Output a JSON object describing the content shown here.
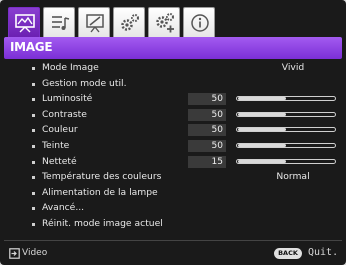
{
  "tabs": [
    {
      "icon": "display-picture-icon",
      "active": true
    },
    {
      "icon": "audio-settings-icon",
      "active": false
    },
    {
      "icon": "install-icon",
      "active": false
    },
    {
      "icon": "system-setup-icon",
      "active": false
    },
    {
      "icon": "advanced-setup-icon",
      "active": false
    },
    {
      "icon": "information-icon",
      "active": false
    }
  ],
  "section_title": "IMAGE",
  "menu": [
    {
      "label": "Mode Image",
      "value": "Vivid"
    },
    {
      "label": "Gestion mode util."
    },
    {
      "label": "Luminosité",
      "number": "50",
      "level": 0.5
    },
    {
      "label": "Contraste",
      "number": "50",
      "level": 0.5
    },
    {
      "label": "Couleur",
      "number": "50",
      "level": 0.5
    },
    {
      "label": "Teinte",
      "number": "50",
      "level": 0.5
    },
    {
      "label": "Netteté",
      "number": "15",
      "level": 0.5
    },
    {
      "label": "Température des couleurs",
      "value": "Normal"
    },
    {
      "label": "Alimentation de la lampe"
    },
    {
      "label": "Avancé..."
    },
    {
      "label": "Réinit. mode image actuel"
    }
  ],
  "footer": {
    "source_icon": "input-source-icon",
    "source": "Video",
    "back_button": "BACK",
    "exit": "Quit."
  },
  "colors": {
    "accent": "#8a3ed1",
    "background": "#1a1a1a"
  }
}
